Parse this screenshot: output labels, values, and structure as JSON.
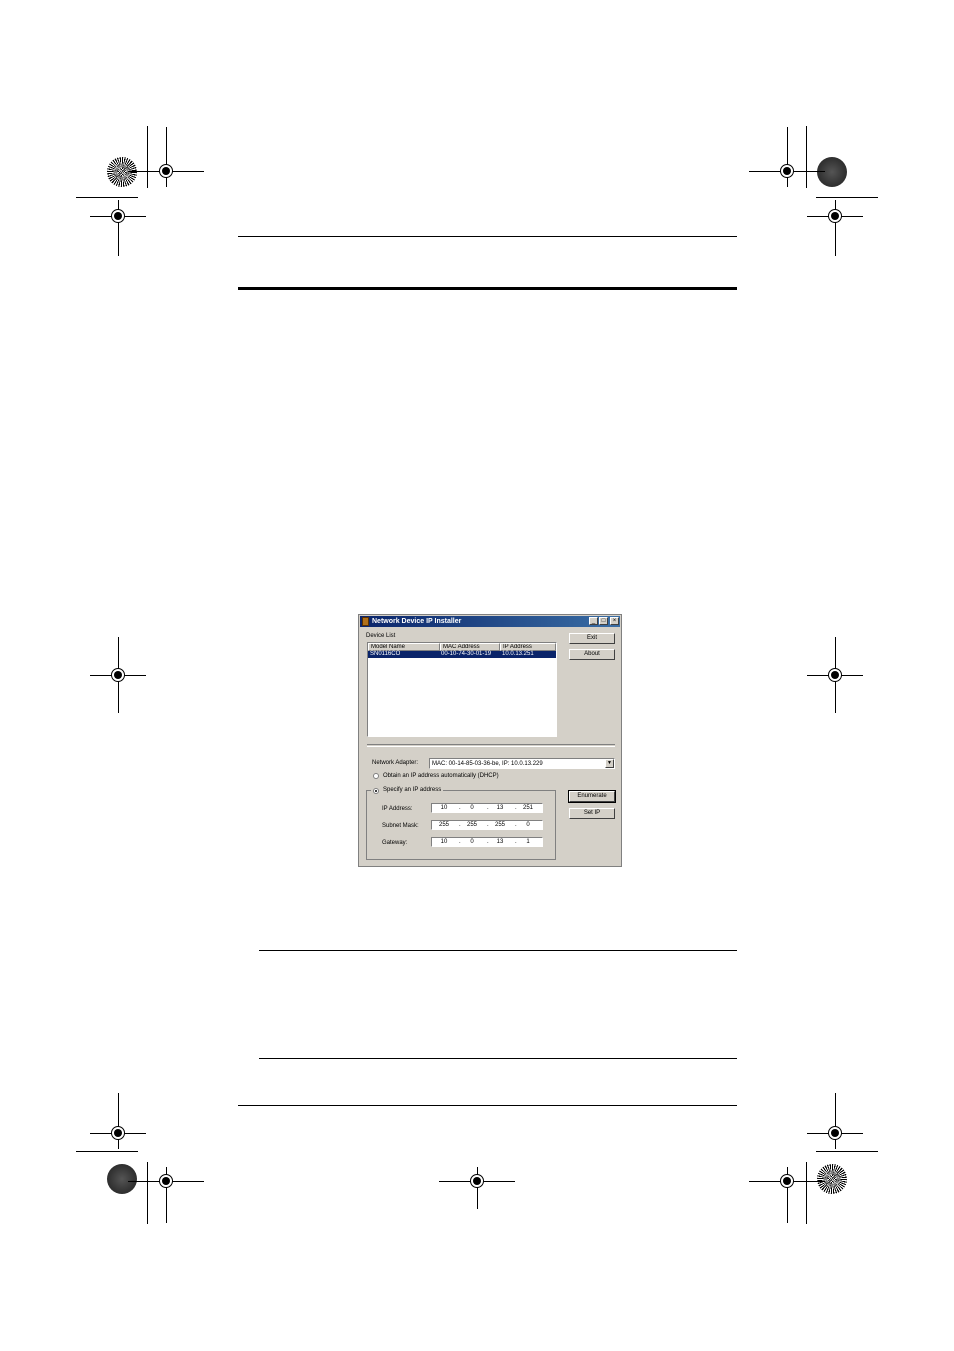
{
  "window": {
    "title": "Network Device IP Installer",
    "minimize_glyph": "_",
    "maximize_glyph": "□",
    "close_glyph": "×"
  },
  "device_list": {
    "label": "Device List",
    "columns": [
      "Model Name",
      "MAC Address",
      "IP Address"
    ],
    "rows": [
      {
        "model": "SN0116CO",
        "mac": "00-10-74-30-01-19",
        "ip": "10.0.13.251"
      }
    ]
  },
  "buttons": {
    "exit": "Exit",
    "about": "About",
    "enumerate": "Enumerate",
    "set_ip": "Set IP"
  },
  "network_adapter": {
    "label": "Network Adapter:",
    "value": "MAC: 00-14-85-03-36-be,  IP: 10.0.13.229"
  },
  "options": {
    "dhcp_label": "Obtain an IP address automatically (DHCP)",
    "dhcp_selected": false,
    "specify_label": "Specify an IP address",
    "specify_selected": true
  },
  "ip_fields": {
    "ip_label": "IP Address:",
    "ip": [
      "10",
      "0",
      "13",
      "251"
    ],
    "mask_label": "Subnet Mask:",
    "mask": [
      "255",
      "255",
      "255",
      "0"
    ],
    "gateway_label": "Gateway:",
    "gateway": [
      "10",
      "0",
      "13",
      "1"
    ]
  },
  "colors": {
    "titlebar": "#0a246a",
    "dialog_bg": "#d4d0c8",
    "selection": "#0a246a"
  }
}
